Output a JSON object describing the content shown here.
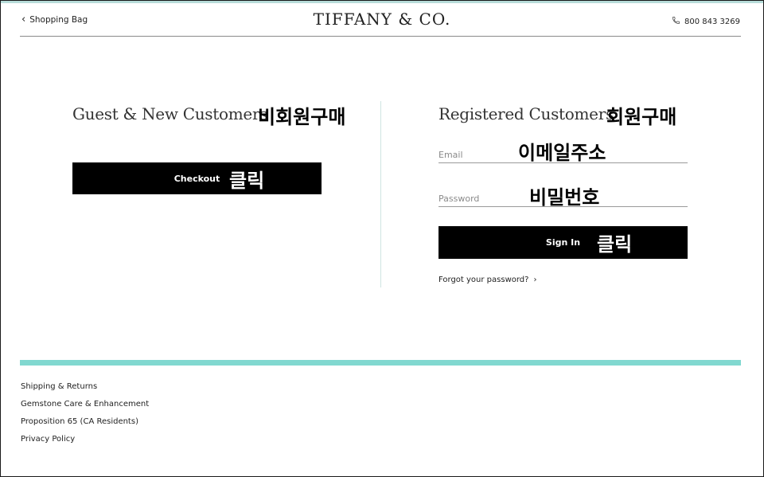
{
  "header": {
    "back_label": "Shopping Bag",
    "logo": "TIFFANY & CO.",
    "phone": "800 843 3269"
  },
  "guest": {
    "title": "Guest & New Customers",
    "title_annotation": "비회원구매",
    "button_label": "Checkout",
    "button_annotation": "클릭"
  },
  "registered": {
    "title": "Registered Customers",
    "title_annotation": "회원구매",
    "email_placeholder": "Email",
    "email_annotation": "이메일주소",
    "password_placeholder": "Password",
    "password_annotation": "비밀번호",
    "button_label": "Sign In",
    "button_annotation": "클릭",
    "forgot_label": "Forgot your password?"
  },
  "footer": {
    "links": [
      "Shipping & Returns",
      "Gemstone Care & Enhancement",
      "Proposition 65 (CA Residents)",
      "Privacy Policy"
    ]
  },
  "colors": {
    "accent": "#81d8d0",
    "button": "#000000"
  },
  "icons": [
    "chevron-left-icon",
    "phone-icon",
    "chevron-right-icon"
  ]
}
